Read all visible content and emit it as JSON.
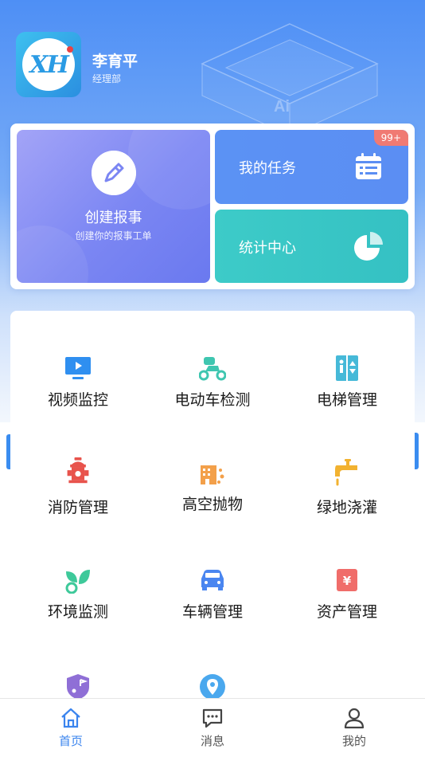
{
  "user": {
    "name": "李育平",
    "department": "经理部",
    "avatar_text": "XH"
  },
  "hero": {
    "deco_text": "Ai"
  },
  "cards": {
    "create": {
      "title": "创建报事",
      "subtitle": "创建你的报事工单",
      "icon": "edit-pen-icon"
    },
    "tasks": {
      "title": "我的任务",
      "badge": "99+",
      "icon": "calendar-list-icon"
    },
    "stats": {
      "title": "统计中心",
      "icon": "pie-chart-icon"
    }
  },
  "grid": [
    {
      "label": "视频监控",
      "icon": "monitor-play-icon",
      "color": "#2f8ff0"
    },
    {
      "label": "电动车检测",
      "icon": "scooter-icon",
      "color": "#3fc6b0"
    },
    {
      "label": "电梯管理",
      "icon": "elevator-icon",
      "color": "#46b9d8"
    },
    {
      "label": "消防管理",
      "icon": "fire-hydrant-icon",
      "color": "#e8534c"
    },
    {
      "label": "高空抛物",
      "icon": "building-falling-icon",
      "color": "#f3a04a"
    },
    {
      "label": "绿地浇灌",
      "icon": "faucet-icon",
      "color": "#f2b230"
    },
    {
      "label": "环境监测",
      "icon": "leaf-icon",
      "color": "#3ec99a"
    },
    {
      "label": "车辆管理",
      "icon": "car-icon",
      "color": "#4a86f0"
    },
    {
      "label": "资产管理",
      "icon": "asset-yen-icon",
      "color": "#f06d6a"
    },
    {
      "label": "",
      "icon": "shield-route-icon",
      "color": "#8f6fd6"
    },
    {
      "label": "",
      "icon": "map-pin-icon",
      "color": "#4aa8ee"
    }
  ],
  "bottom_nav": [
    {
      "label": "首页",
      "icon": "home-icon",
      "active": true
    },
    {
      "label": "消息",
      "icon": "message-icon",
      "active": false
    },
    {
      "label": "我的",
      "icon": "user-icon",
      "active": false
    }
  ],
  "colors": {
    "primary": "#3a84ee",
    "create_card": "#7b86f3",
    "task_card": "#5b8ef3",
    "stats_card": "#3cc8c6",
    "badge": "#f07a73"
  }
}
